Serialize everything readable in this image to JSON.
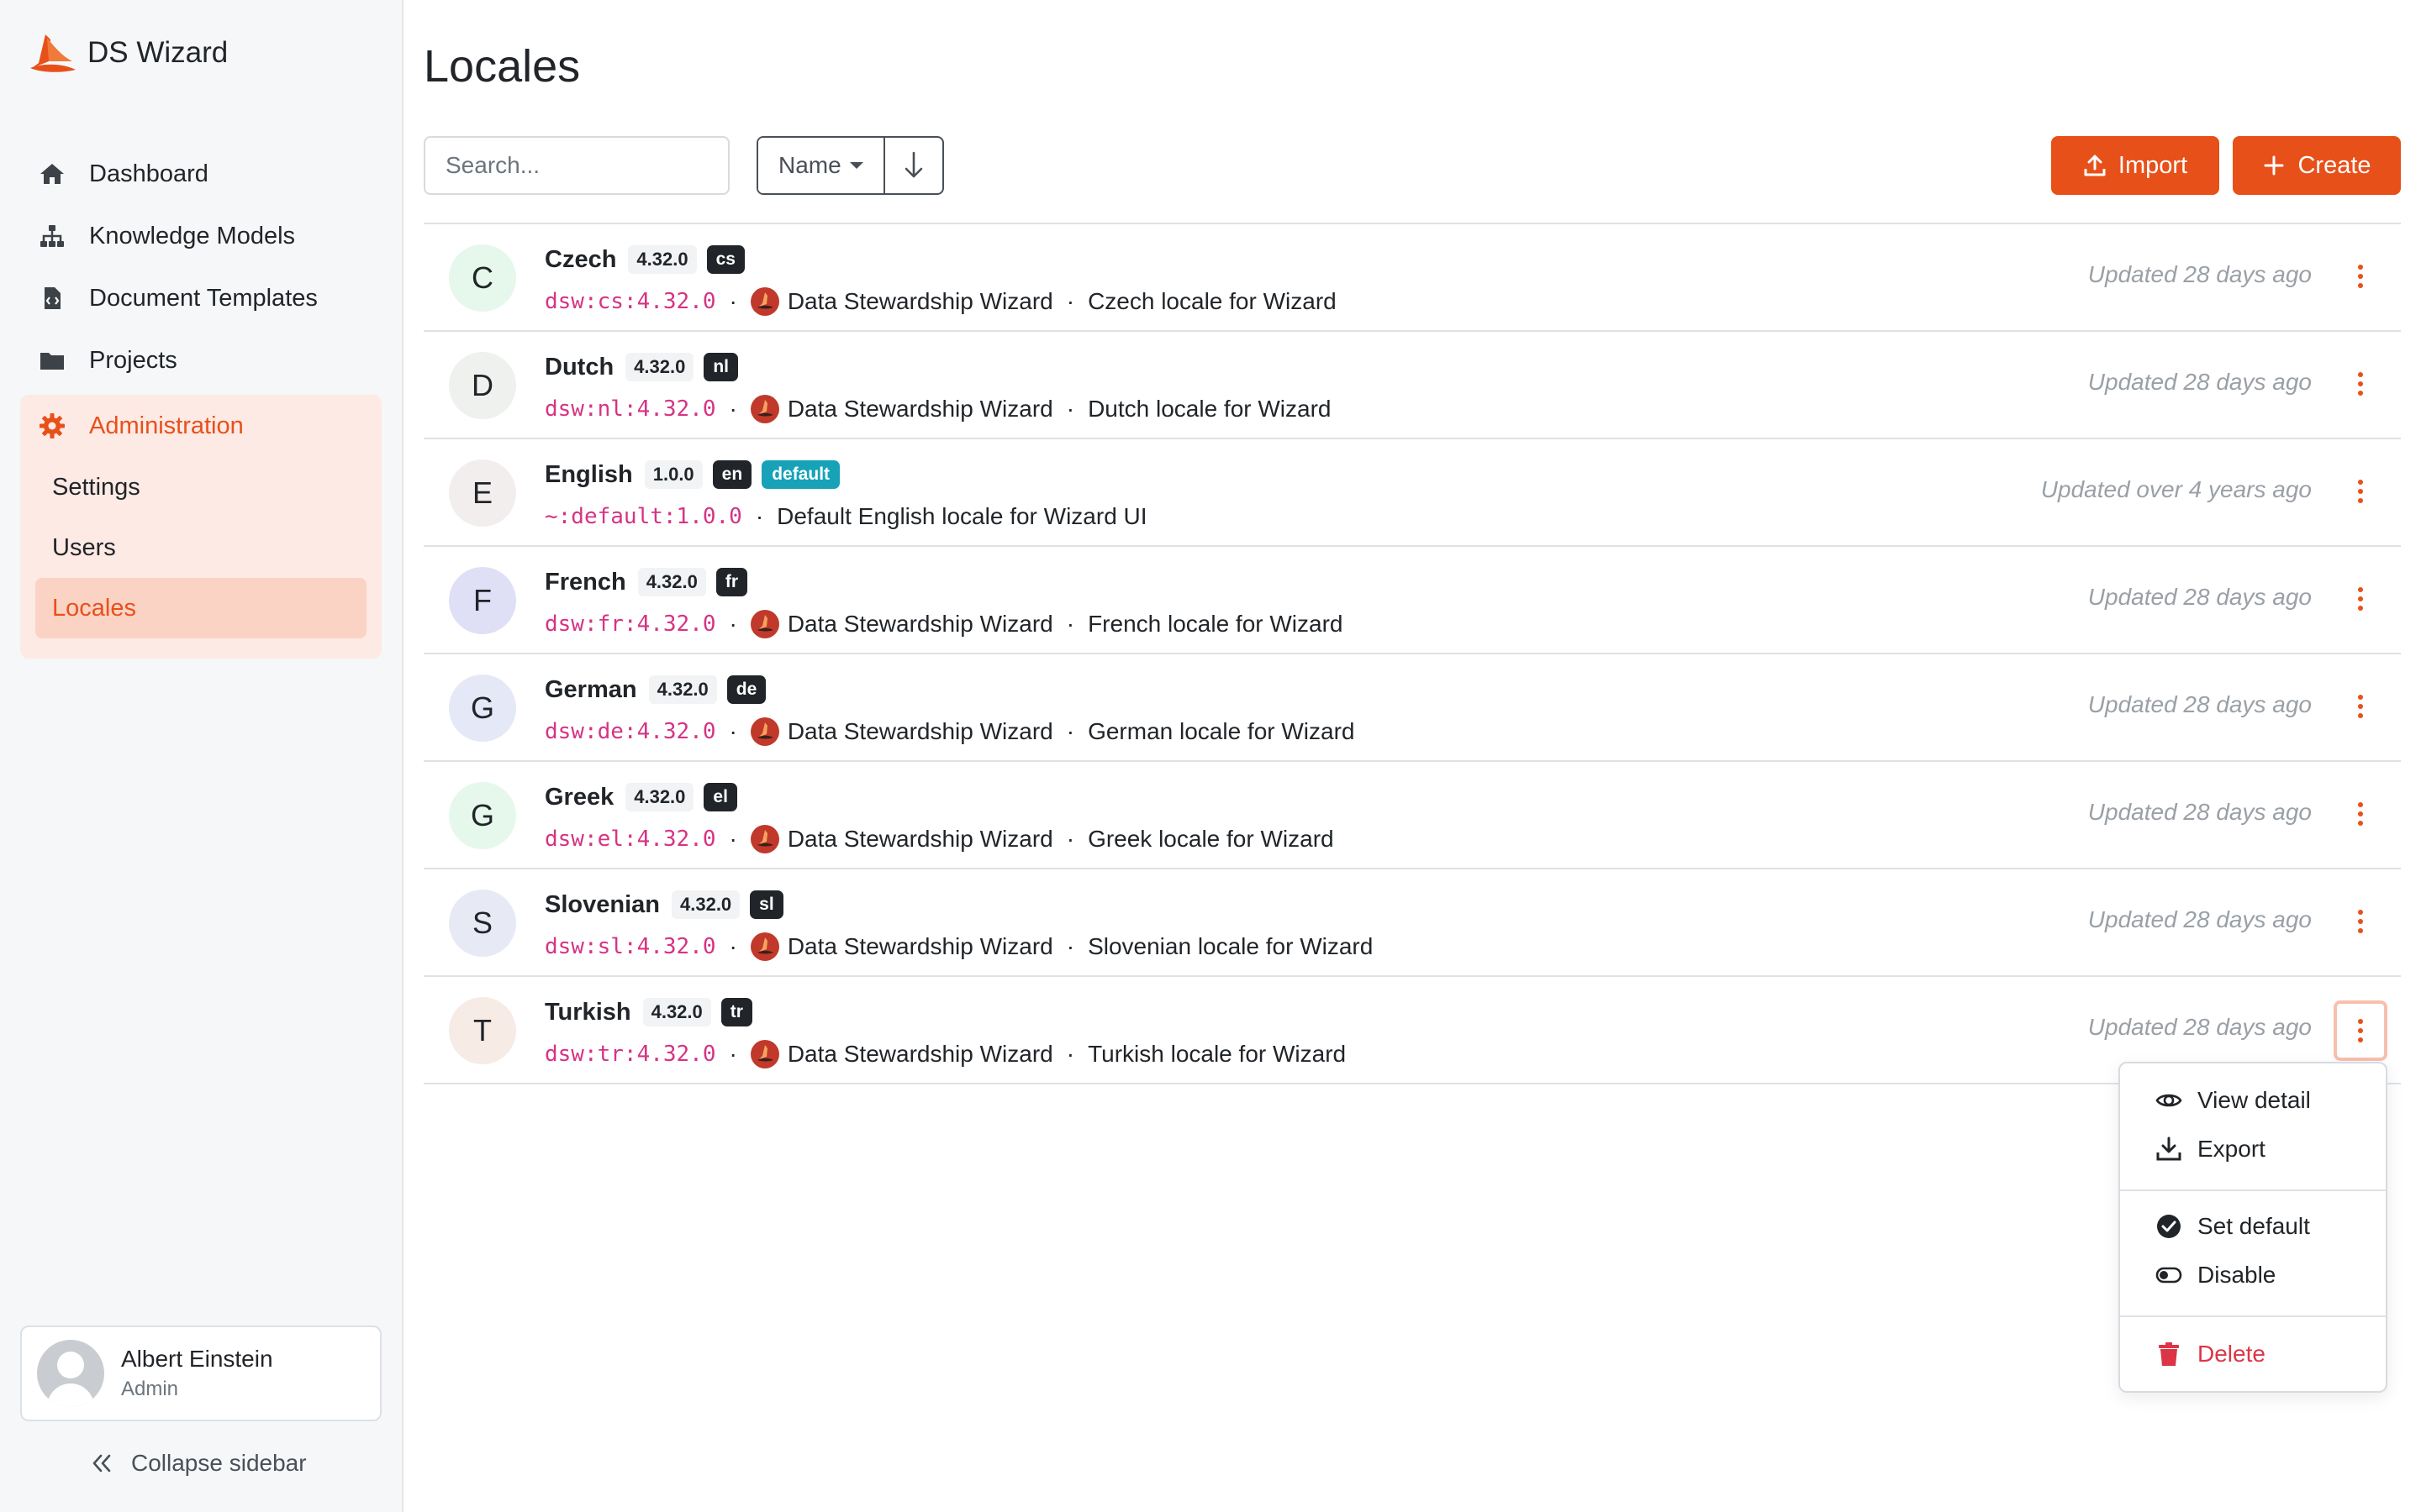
{
  "app": {
    "name": "DS Wizard",
    "accent": "#e8501a"
  },
  "nav": {
    "dashboard": "Dashboard",
    "knowledge_models": "Knowledge Models",
    "document_templates": "Document Templates",
    "projects": "Projects",
    "administration": "Administration",
    "admin_items": [
      "Settings",
      "Users",
      "Locales"
    ]
  },
  "user": {
    "name": "Albert Einstein",
    "role": "Admin"
  },
  "collapse_label": "Collapse sidebar",
  "page": {
    "title": "Locales"
  },
  "toolbar": {
    "search_placeholder": "Search...",
    "sort_label": "Name",
    "import_label": "Import",
    "create_label": "Create"
  },
  "locales": [
    {
      "initial": "C",
      "avatar_color": "#e6f7ec",
      "name": "Czech",
      "version": "4.32.0",
      "code": "cs",
      "default_label": "",
      "id": "dsw:cs:4.32.0",
      "org": "Data Stewardship Wizard",
      "description": "Czech locale for Wizard",
      "updated": "Updated 28 days ago"
    },
    {
      "initial": "D",
      "avatar_color": "#eef1ee",
      "name": "Dutch",
      "version": "4.32.0",
      "code": "nl",
      "default_label": "",
      "id": "dsw:nl:4.32.0",
      "org": "Data Stewardship Wizard",
      "description": "Dutch locale for Wizard",
      "updated": "Updated 28 days ago"
    },
    {
      "initial": "E",
      "avatar_color": "#f3eeee",
      "name": "English",
      "version": "1.0.0",
      "code": "en",
      "default_label": "default",
      "id": "~:default:1.0.0",
      "org": "",
      "description": "Default English locale for Wizard UI",
      "updated": "Updated over 4 years ago"
    },
    {
      "initial": "F",
      "avatar_color": "#dfe0f5",
      "name": "French",
      "version": "4.32.0",
      "code": "fr",
      "default_label": "",
      "id": "dsw:fr:4.32.0",
      "org": "Data Stewardship Wizard",
      "description": "French locale for Wizard",
      "updated": "Updated 28 days ago"
    },
    {
      "initial": "G",
      "avatar_color": "#e5e8f6",
      "name": "German",
      "version": "4.32.0",
      "code": "de",
      "default_label": "",
      "id": "dsw:de:4.32.0",
      "org": "Data Stewardship Wizard",
      "description": "German locale for Wizard",
      "updated": "Updated 28 days ago"
    },
    {
      "initial": "G",
      "avatar_color": "#e6f8ec",
      "name": "Greek",
      "version": "4.32.0",
      "code": "el",
      "default_label": "",
      "id": "dsw:el:4.32.0",
      "org": "Data Stewardship Wizard",
      "description": "Greek locale for Wizard",
      "updated": "Updated 28 days ago"
    },
    {
      "initial": "S",
      "avatar_color": "#e7eaf5",
      "name": "Slovenian",
      "version": "4.32.0",
      "code": "sl",
      "default_label": "",
      "id": "dsw:sl:4.32.0",
      "org": "Data Stewardship Wizard",
      "description": "Slovenian locale for Wizard",
      "updated": "Updated 28 days ago"
    },
    {
      "initial": "T",
      "avatar_color": "#f7ebe6",
      "name": "Turkish",
      "version": "4.32.0",
      "code": "tr",
      "default_label": "",
      "id": "dsw:tr:4.32.0",
      "org": "Data Stewardship Wizard",
      "description": "Turkish locale for Wizard",
      "updated": "Updated 28 days ago"
    }
  ],
  "dropdown": {
    "view_detail": "View detail",
    "export": "Export",
    "set_default": "Set default",
    "disable": "Disable",
    "delete": "Delete"
  }
}
